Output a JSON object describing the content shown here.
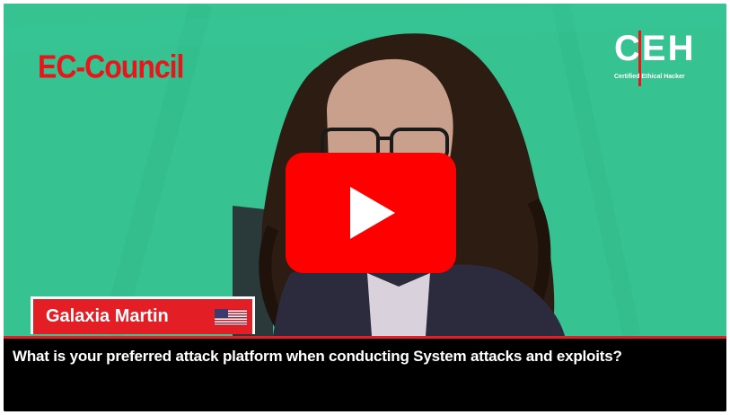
{
  "brand": {
    "left_logo_text": "EC-Council",
    "right_logo_letters": "CEH",
    "right_logo_sub": "Certified Ethical Hacker"
  },
  "player": {
    "play_button": "youtube-play-icon"
  },
  "speaker": {
    "name": "Galaxia Martin",
    "flag": "us-flag-icon"
  },
  "caption": {
    "text": "What is your preferred attack platform when conducting System attacks and exploits?"
  },
  "colors": {
    "green_screen": "#36c291",
    "brand_red": "#e31e24",
    "youtube_red": "#ff0000"
  }
}
